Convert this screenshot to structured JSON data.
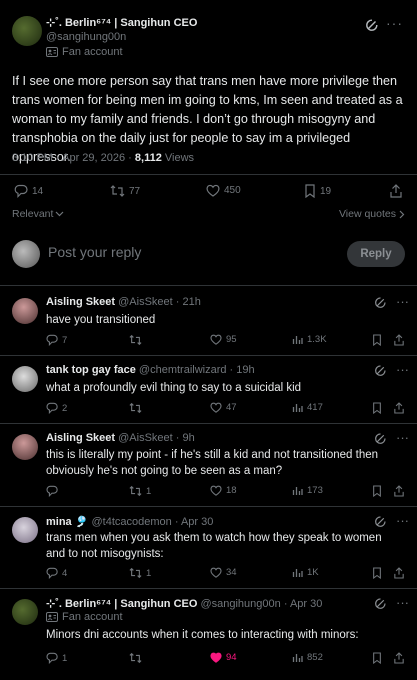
{
  "main_post": {
    "author_name": "⊹˚. Berlin⁶⁷⁴ | Sangihun CEO",
    "handle": "@sangihung00n",
    "fan_label": "Fan account",
    "text": "If I see one more person say that trans men have more privilege then trans women for being men im going to kms, Im seen and treated as a woman to my family and friends. I don’t go through misogyny and transphobia on the daily just for people to say im a privileged oppressor.",
    "timestamp": "3:10 PM · Apr 29, 2026 · ",
    "views_count": "8,112",
    "views_label": " Views",
    "replies": "14",
    "reposts": "77",
    "likes": "450",
    "bookmarks": "19"
  },
  "filters": {
    "sort_label": "Relevant",
    "view_quotes_label": "View quotes"
  },
  "compose": {
    "placeholder": "Post your reply",
    "reply_button": "Reply"
  },
  "replies": [
    {
      "name": "Aisling Skeet",
      "handle": "@AisSkeet",
      "time": "21h",
      "text": "have you transitioned",
      "replies": "7",
      "reposts": "",
      "likes": "95",
      "views": "1.3K"
    },
    {
      "name": "tank top gay face",
      "handle": "@chemtrailwizard",
      "time": "19h",
      "text": "what a profoundly evil thing to say to a suicidal kid",
      "replies": "2",
      "reposts": "",
      "likes": "47",
      "views": "417"
    },
    {
      "name": "Aisling Skeet",
      "handle": "@AisSkeet",
      "time": "9h",
      "text": "this is literally my point - if he's still a kid and not transitioned then obviously he's not going to be seen as a man?",
      "replies": "",
      "reposts": "1",
      "likes": "18",
      "views": "173"
    },
    {
      "name": "mina",
      "name_suffix": "🎐",
      "handle": "@t4tcacodemon",
      "time": "Apr 30",
      "text": "trans men when you ask them to watch how they speak to women and to not misogynists:",
      "replies": "4",
      "reposts": "1",
      "likes": "34",
      "views": "1K"
    },
    {
      "name": "⊹˚. Berlin⁶⁷⁴ | Sangihun CEO",
      "handle": "@sangihung00n",
      "time": "Apr 30",
      "fan_label": "Fan account",
      "text": "Minors dni accounts when it comes to interacting with minors:",
      "replies": "1",
      "reposts": "",
      "likes": "94",
      "views": "852"
    }
  ],
  "colors": {
    "background": "#000000",
    "text": "#e7e9ea",
    "muted": "#71767b",
    "divider": "#2f3336",
    "like_active": "#f91880"
  }
}
